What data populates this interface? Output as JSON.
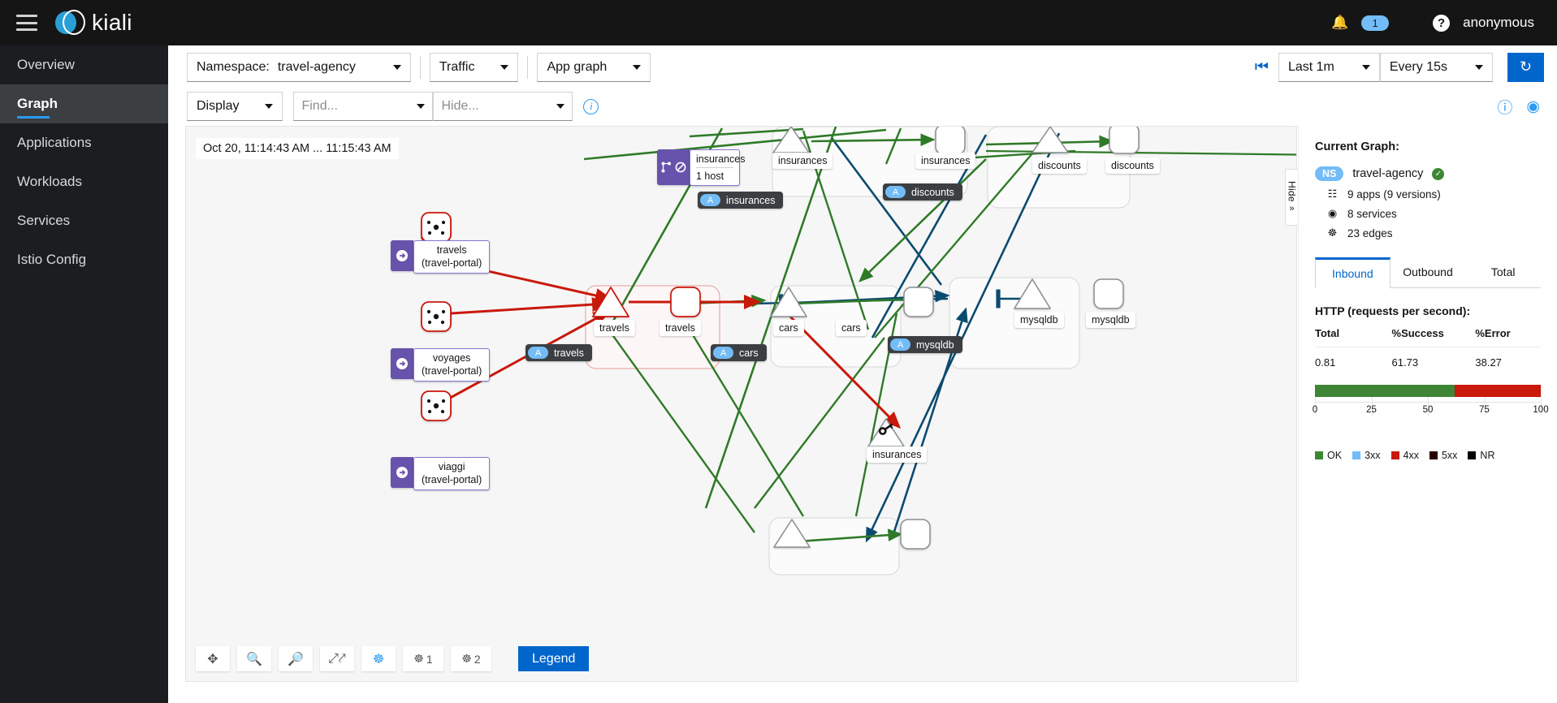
{
  "masthead": {
    "menu_icon": "hamburger-icon",
    "brand": "kiali",
    "bell_icon": "bell-icon",
    "notification_count": "1",
    "help_icon": "question-circle-icon",
    "user": "anonymous"
  },
  "sidebar": {
    "items": [
      {
        "label": "Overview",
        "active": false
      },
      {
        "label": "Graph",
        "active": true
      },
      {
        "label": "Applications",
        "active": false
      },
      {
        "label": "Workloads",
        "active": false
      },
      {
        "label": "Services",
        "active": false
      },
      {
        "label": "Istio Config",
        "active": false
      }
    ]
  },
  "toolbar": {
    "namespace_label": "Namespace:",
    "namespace_value": "travel-agency",
    "traffic": "Traffic",
    "graph_type": "App graph",
    "display": "Display",
    "find_placeholder": "Find...",
    "hide_placeholder": "Hide...",
    "info_icon": "info-circle-icon",
    "history_icon": "history-icon",
    "time_range": "Last 1m",
    "refresh_interval": "Every 15s",
    "refresh_icon": "sync-icon",
    "help_icon": "question-circle-icon",
    "settings_icon": "display-settings-icon"
  },
  "graph": {
    "timestamp": "Oct 20, 11:14:43 AM ... 11:15:43 AM",
    "tools": [
      {
        "name": "drag-pan-button",
        "glyph": "✥",
        "label": ""
      },
      {
        "name": "zoom-in-button",
        "glyph": "⊕",
        "label": ""
      },
      {
        "name": "zoom-out-button",
        "glyph": "⊖",
        "label": ""
      },
      {
        "name": "fit-to-screen-button",
        "glyph": "⤢",
        "label": ""
      },
      {
        "name": "layout-default-button",
        "glyph": "⚛",
        "label": ""
      },
      {
        "name": "layout-1-button",
        "glyph": "⚛",
        "label": "1"
      },
      {
        "name": "layout-2-button",
        "glyph": "⚛",
        "label": "2"
      }
    ],
    "legend_button": "Legend",
    "hide_panel_tab": "Hide",
    "hide_panel_chevron": "»",
    "nodes": [
      {
        "id": "se-travels",
        "label": "travels\n(travel-portal)",
        "type": "service-entry"
      },
      {
        "id": "se-voyages",
        "label": "voyages\n(travel-portal)",
        "type": "service-entry"
      },
      {
        "id": "se-viaggi",
        "label": "viaggi\n(travel-portal)",
        "type": "service-entry"
      },
      {
        "id": "svc-travels",
        "label": "travels",
        "type": "service"
      },
      {
        "id": "app-travels",
        "label": "travels",
        "type": "app"
      },
      {
        "id": "grp-travels",
        "label": "travels",
        "type": "group"
      },
      {
        "id": "svc-insurances",
        "label": "insurances",
        "type": "service"
      },
      {
        "id": "app-insurances",
        "label": "insurances",
        "type": "app"
      },
      {
        "id": "grp-insurances",
        "label": "insurances",
        "type": "group"
      },
      {
        "id": "vs-insurances",
        "label": "insurances",
        "sublabel": "1 host",
        "type": "virtual-service"
      },
      {
        "id": "svc-discounts",
        "label": "discounts",
        "type": "service"
      },
      {
        "id": "app-discounts",
        "label": "discounts",
        "type": "app"
      },
      {
        "id": "grp-discounts",
        "label": "discounts",
        "type": "group"
      },
      {
        "id": "svc-cars",
        "label": "cars",
        "type": "service"
      },
      {
        "id": "app-cars",
        "label": "cars",
        "type": "app"
      },
      {
        "id": "grp-cars",
        "label": "cars",
        "type": "group"
      },
      {
        "id": "svc-mysqldb",
        "label": "mysqldb",
        "type": "service"
      },
      {
        "id": "app-mysqldb",
        "label": "mysqldb",
        "type": "app"
      },
      {
        "id": "grp-mysqldb",
        "label": "mysqldb",
        "type": "group"
      },
      {
        "id": "key-insurances",
        "label": "insurances",
        "type": "service-key"
      }
    ]
  },
  "side_panel": {
    "title": "Current Graph:",
    "ns_badge": "NS",
    "namespace": "travel-agency",
    "health_icon": "check-circle-icon",
    "stats": [
      {
        "icon": "apps-icon",
        "text": "9 apps (9 versions)"
      },
      {
        "icon": "services-icon",
        "text": "8 services"
      },
      {
        "icon": "edges-icon",
        "text": "23 edges"
      }
    ],
    "tabs": [
      {
        "label": "Inbound",
        "active": true
      },
      {
        "label": "Outbound",
        "active": false
      },
      {
        "label": "Total",
        "active": false
      }
    ],
    "metrics_title": "HTTP (requests per second):",
    "table": {
      "headers": [
        "Total",
        "%Success",
        "%Error"
      ],
      "rows": [
        [
          "0.81",
          "61.73",
          "38.27"
        ]
      ]
    }
  },
  "chart_data": {
    "type": "bar",
    "orientation": "horizontal",
    "stacked": true,
    "title": "",
    "xlabel": "",
    "ylabel": "",
    "xlim": [
      0,
      100
    ],
    "ticks": [
      0,
      25,
      50,
      75,
      100
    ],
    "grid": true,
    "legend_position": "bottom",
    "categories": [
      "HTTP requests"
    ],
    "series": [
      {
        "name": "OK",
        "color": "#3e8635",
        "values": [
          61.73
        ]
      },
      {
        "name": "3xx",
        "color": "#73bcf7",
        "values": [
          0
        ]
      },
      {
        "name": "4xx",
        "color": "#c9190b",
        "values": [
          38.27
        ]
      },
      {
        "name": "5xx",
        "color": "#2c0000",
        "values": [
          0
        ]
      },
      {
        "name": "NR",
        "color": "#030303",
        "values": [
          0
        ]
      }
    ]
  },
  "colors": {
    "accent": "#0066cc",
    "brand": "#2a9fd6",
    "ok": "#3e8635",
    "error": "#c9190b",
    "tcp": "#0b4a6f",
    "purple": "#6753ac"
  }
}
